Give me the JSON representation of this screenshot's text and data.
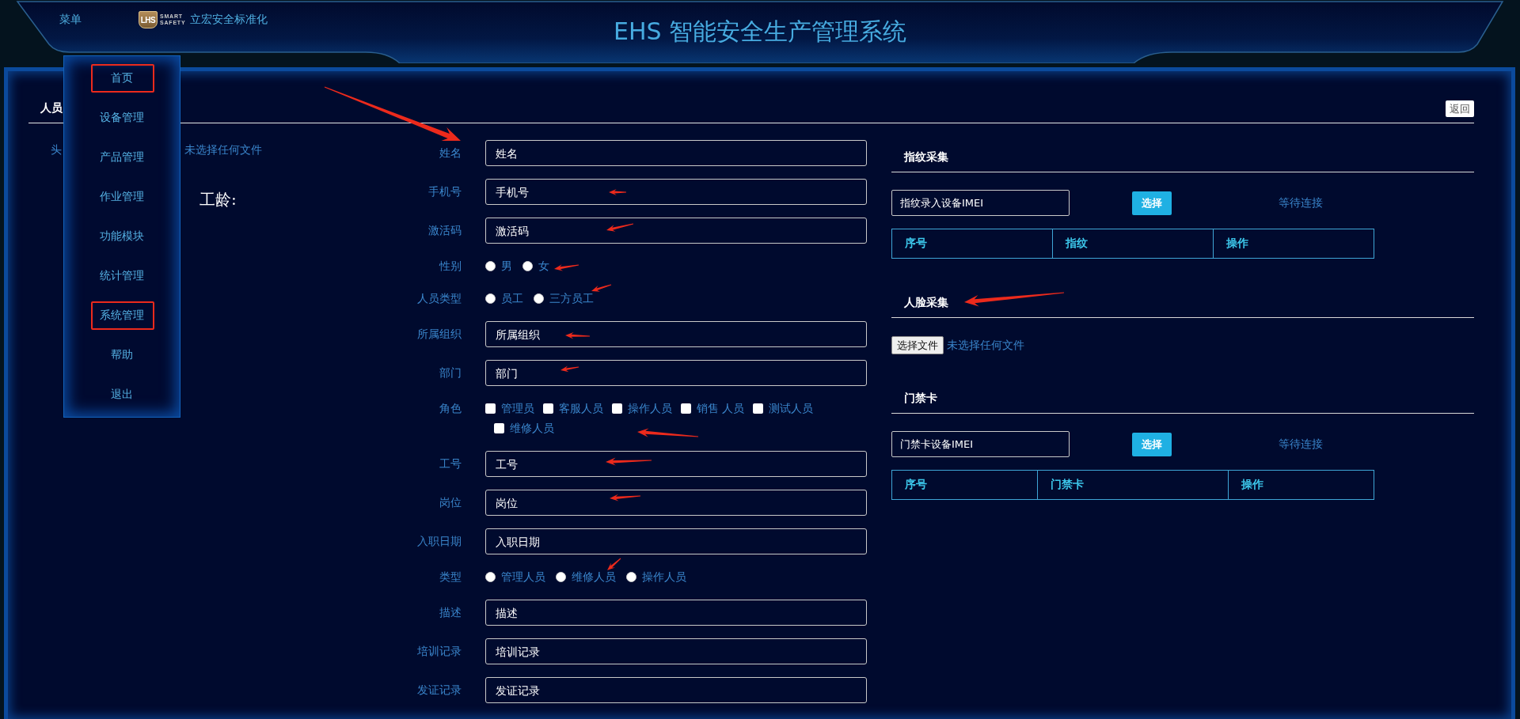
{
  "header": {
    "menu": {
      "label": "菜单",
      "expanded": true,
      "items": [
        {
          "label": "首页",
          "highlighted": true
        },
        {
          "label": "设备管理",
          "highlighted": false
        },
        {
          "label": "产品管理",
          "highlighted": false
        },
        {
          "label": "作业管理",
          "highlighted": false
        },
        {
          "label": "功能模块",
          "highlighted": false
        },
        {
          "label": "统计管理",
          "highlighted": false
        },
        {
          "label": "系统管理",
          "highlighted": true
        },
        {
          "label": "帮助",
          "highlighted": false
        },
        {
          "label": "退出",
          "highlighted": false
        }
      ]
    },
    "logo": {
      "mark": "LHS",
      "line_1": "SMART",
      "line_2": "SAFETY"
    },
    "brand": "立宏安全标准化",
    "title": "EHS 智能安全生产管理系统"
  },
  "page": {
    "title": "人员",
    "back_button": "返回"
  },
  "photo_field": {
    "label": "头",
    "status": "未选择任何文件"
  },
  "seniority": {
    "label": "工龄:"
  },
  "form": {
    "fields": [
      {
        "kind": "text",
        "label": "姓名",
        "placeholder": "姓名"
      },
      {
        "kind": "text",
        "label": "手机号",
        "placeholder": "手机号"
      },
      {
        "kind": "text",
        "label": "激活码",
        "placeholder": "激活码"
      },
      {
        "kind": "radio",
        "label": "性别",
        "options": [
          {
            "label": "男",
            "selected": false
          },
          {
            "label": "女",
            "selected": false
          }
        ]
      },
      {
        "kind": "radio",
        "label": "人员类型",
        "options": [
          {
            "label": "员工",
            "selected": false
          },
          {
            "label": "三方员工",
            "selected": false
          }
        ]
      },
      {
        "kind": "text",
        "label": "所属组织",
        "placeholder": "所属组织"
      },
      {
        "kind": "text",
        "label": "部门",
        "placeholder": "部门"
      },
      {
        "kind": "checkbox",
        "label": "角色",
        "options": [
          {
            "label": "管理员",
            "checked": false
          },
          {
            "label": "客服人员",
            "checked": false
          },
          {
            "label": "操作人员",
            "checked": false
          },
          {
            "label": "销售 人员",
            "checked": false
          },
          {
            "label": "测试人员",
            "checked": false
          },
          {
            "label": "维修人员",
            "checked": false
          }
        ]
      },
      {
        "kind": "text",
        "label": "工号",
        "placeholder": "工号"
      },
      {
        "kind": "text",
        "label": "岗位",
        "placeholder": "岗位"
      },
      {
        "kind": "text",
        "label": "入职日期",
        "placeholder": "入职日期"
      },
      {
        "kind": "radio",
        "label": "类型",
        "options": [
          {
            "label": "管理人员",
            "selected": false
          },
          {
            "label": "维修人员",
            "selected": false
          },
          {
            "label": "操作人员",
            "selected": false
          }
        ]
      },
      {
        "kind": "text",
        "label": "描述",
        "placeholder": "描述"
      },
      {
        "kind": "text",
        "label": "培训记录",
        "placeholder": "培训记录"
      },
      {
        "kind": "text",
        "label": "发证记录",
        "placeholder": "发证记录"
      }
    ]
  },
  "capture_panel": {
    "sections": [
      {
        "kind": "device",
        "title": "指纹采集",
        "placeholder": "指纹录入设备IMEI",
        "button": "选择",
        "status": "等待连接",
        "columns": [
          "序号",
          "指纹",
          "操作"
        ]
      },
      {
        "kind": "upload",
        "title": "人脸采集",
        "button": "选择文件",
        "status": "未选择任何文件"
      },
      {
        "kind": "device",
        "title": "门禁卡",
        "placeholder": "门禁卡设备IMEI",
        "button": "选择",
        "status": "等待连接",
        "columns": [
          "序号",
          "门禁卡",
          "操作"
        ]
      }
    ]
  }
}
